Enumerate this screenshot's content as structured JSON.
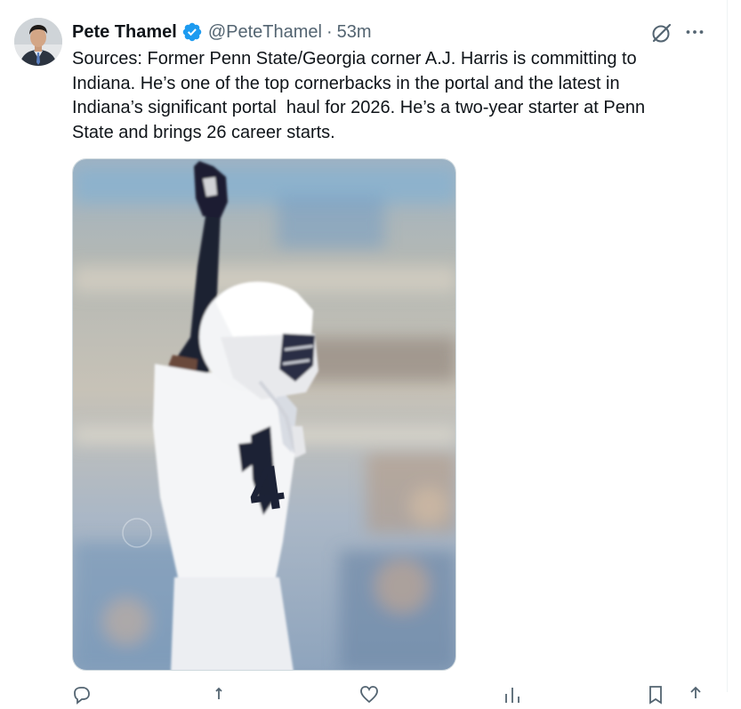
{
  "tweet": {
    "author_name": "Pete Thamel",
    "handle": "@PeteThamel",
    "separator": "·",
    "time": "53m",
    "text": "Sources: Former Penn State/Georgia corner A.J. Harris is committing to\nIndiana. He’s one of the top cornerbacks in the portal and the latest in\nIndiana’s significant portal  haul for 2026. He’s a two-year starter at Penn\nState and brings 26 career starts.",
    "verified_color": "#1d9bf0",
    "icons": {
      "verified": "verified-badge-icon",
      "grok": "grok-icon",
      "more": "more-options-icon"
    },
    "photo": {
      "jersey_number": "4"
    }
  }
}
